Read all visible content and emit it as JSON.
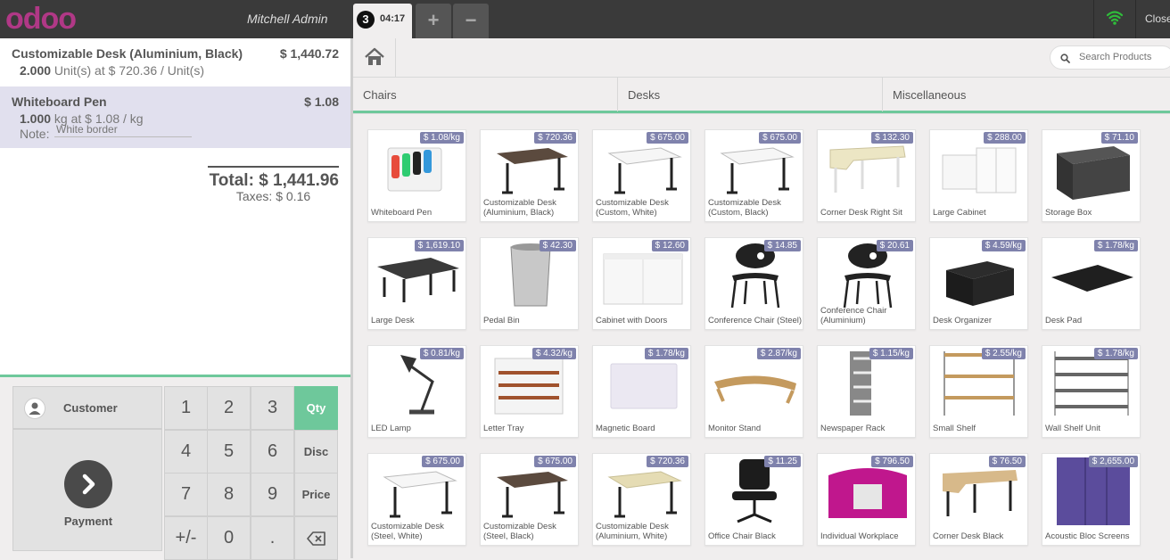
{
  "topbar": {
    "logo": "odoo",
    "username": "Mitchell Admin",
    "order_number": "3",
    "order_time": "04:17",
    "add_label": "+",
    "remove_label": "−",
    "close_label": "Close",
    "wifi_color": "#2fbc3a"
  },
  "orderlines": [
    {
      "name": "Customizable Desk (Aluminium, Black)",
      "price": "$ 1,440.72",
      "qty": "2.000",
      "unit_info": " Unit(s) at $ 720.36 / Unit(s)"
    },
    {
      "name": "Whiteboard Pen",
      "price": "$ 1.08",
      "qty": "1.000",
      "unit_info": " kg at $ 1.08 / kg",
      "note_label": "Note:",
      "note_value": "White border"
    }
  ],
  "totals": {
    "total": "Total: $ 1,441.96",
    "taxes": "Taxes: $ 0.16"
  },
  "pad": {
    "customer_label": "Customer",
    "payment_label": "Payment",
    "keys": [
      "1",
      "2",
      "3",
      "4",
      "5",
      "6",
      "7",
      "8",
      "9",
      "+/-",
      "0",
      "."
    ],
    "modes": [
      "Qty",
      "Disc",
      "Price"
    ],
    "selected_mode": "Qty",
    "accent_color": "#6ec89b"
  },
  "search": {
    "placeholder": "Search Products"
  },
  "categories": [
    "Chairs",
    "Desks",
    "Miscellaneous"
  ],
  "products": [
    {
      "name": "Whiteboard Pen",
      "price": "$ 1.08/kg",
      "icon": "pens"
    },
    {
      "name": "Customizable Desk (Aluminium, Black)",
      "price": "$ 720.36",
      "icon": "desk-dark"
    },
    {
      "name": "Customizable Desk (Custom, White)",
      "price": "$ 675.00",
      "icon": "desk-white"
    },
    {
      "name": "Customizable Desk (Custom, Black)",
      "price": "$ 675.00",
      "icon": "desk-white"
    },
    {
      "name": "Corner Desk Right Sit",
      "price": "$ 132.30",
      "icon": "desk-corner-light"
    },
    {
      "name": "Large Cabinet",
      "price": "$ 288.00",
      "icon": "cabinet-white"
    },
    {
      "name": "Storage Box",
      "price": "$ 71.10",
      "icon": "box"
    },
    {
      "name": "Large Desk",
      "price": "$ 1,619.10",
      "icon": "desk-large"
    },
    {
      "name": "Pedal Bin",
      "price": "$ 42.30",
      "icon": "bin"
    },
    {
      "name": "Cabinet with Doors",
      "price": "$ 12.60",
      "icon": "cabinet-doors"
    },
    {
      "name": "Conference Chair (Steel)",
      "price": "$ 14.85",
      "icon": "chair"
    },
    {
      "name": "Conference Chair (Aluminium)",
      "price": "$ 20.61",
      "icon": "chair"
    },
    {
      "name": "Desk Organizer",
      "price": "$ 4.59/kg",
      "icon": "organizer"
    },
    {
      "name": "Desk Pad",
      "price": "$ 1.78/kg",
      "icon": "pad"
    },
    {
      "name": "LED Lamp",
      "price": "$ 0.81/kg",
      "icon": "lamp"
    },
    {
      "name": "Letter Tray",
      "price": "$ 4.32/kg",
      "icon": "tray"
    },
    {
      "name": "Magnetic Board",
      "price": "$ 1.78/kg",
      "icon": "board"
    },
    {
      "name": "Monitor Stand",
      "price": "$ 2.87/kg",
      "icon": "stand"
    },
    {
      "name": "Newspaper Rack",
      "price": "$ 1.15/kg",
      "icon": "rack"
    },
    {
      "name": "Small Shelf",
      "price": "$ 2.55/kg",
      "icon": "shelf"
    },
    {
      "name": "Wall Shelf Unit",
      "price": "$ 1.78/kg",
      "icon": "wallshelf"
    },
    {
      "name": "Customizable Desk (Steel, White)",
      "price": "$ 675.00",
      "icon": "desk-white"
    },
    {
      "name": "Customizable Desk (Steel, Black)",
      "price": "$ 675.00",
      "icon": "desk-dark"
    },
    {
      "name": "Customizable Desk (Aluminium, White)",
      "price": "$ 720.36",
      "icon": "desk-light"
    },
    {
      "name": "Office Chair Black",
      "price": "$ 11.25",
      "icon": "office-chair"
    },
    {
      "name": "Individual Workplace",
      "price": "$ 796.50",
      "icon": "workplace"
    },
    {
      "name": "Corner Desk Black",
      "price": "$ 76.50",
      "icon": "desk-corner-wood"
    },
    {
      "name": "Acoustic Bloc Screens",
      "price": "$ 2,655.00",
      "icon": "screens"
    }
  ]
}
